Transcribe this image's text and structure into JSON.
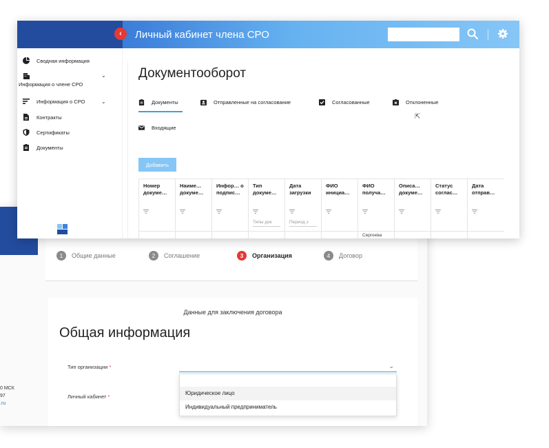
{
  "app": {
    "title": "Личный кабинет члена СРО",
    "search_placeholder": "",
    "accent_color": "#3f9fd8",
    "brand_color": "#234c9e",
    "danger_color": "#e53935"
  },
  "sidebar": {
    "items": [
      {
        "label": "Сводная информация",
        "icon": "chart-pie-icon",
        "expandable": false
      },
      {
        "label": "Информация о члене СРО",
        "icon": "building-icon",
        "expandable": true
      },
      {
        "label": "Информация о СРО",
        "icon": "list-icon",
        "expandable": true
      },
      {
        "label": "Контракты",
        "icon": "file-icon",
        "expandable": false
      },
      {
        "label": "Сертификаты",
        "icon": "shield-icon",
        "expandable": false
      },
      {
        "label": "Документы",
        "icon": "clipboard-icon",
        "expandable": false
      }
    ]
  },
  "main": {
    "title": "Документооборот",
    "tabs": [
      {
        "label": "Документы",
        "icon": "clipboard-icon",
        "active": true
      },
      {
        "label": "Отправленные на согласование",
        "icon": "contact-icon",
        "active": false
      },
      {
        "label": "Согласованные",
        "icon": "checkbox-icon",
        "active": false
      },
      {
        "label": "Отклоненные",
        "icon": "cancel-box-icon",
        "active": false
      },
      {
        "label": "Входящие",
        "icon": "mail-icon",
        "active": false
      }
    ],
    "add_button": "Добавить",
    "table": {
      "columns": [
        {
          "label": "Номер докуме…",
          "filter_placeholder": ""
        },
        {
          "label": "Наиме… докуме…",
          "filter_placeholder": ""
        },
        {
          "label": "Инфор… о подпис…",
          "filter_placeholder": ""
        },
        {
          "label": "Тип докуме…",
          "filter_placeholder": "Типы док"
        },
        {
          "label": "Дата загрузки",
          "filter_placeholder": "Период з"
        },
        {
          "label": "ФИО инициа…",
          "filter_placeholder": ""
        },
        {
          "label": "ФИО получа…",
          "filter_placeholder": ""
        },
        {
          "label": "Описа… докуме…",
          "filter_placeholder": ""
        },
        {
          "label": "Статус соглас…",
          "filter_placeholder": ""
        },
        {
          "label": "Дата отправ…",
          "filter_placeholder": ""
        }
      ],
      "first_row": [
        "",
        "",
        "",
        "",
        "",
        "",
        "Сергеева",
        "",
        "",
        ""
      ]
    }
  },
  "wizard": {
    "steps": [
      {
        "num": "1",
        "label": "Общие данные",
        "active": false
      },
      {
        "num": "2",
        "label": "Соглашение",
        "active": false
      },
      {
        "num": "3",
        "label": "Организация",
        "active": true
      },
      {
        "num": "4",
        "label": "Договор",
        "active": false
      }
    ],
    "form_header": "Данные для заключения договора",
    "section_title": "Общая информация",
    "org_type_label": "Тип организации",
    "cabinet_label": "Личный кабинет",
    "required_mark": "*",
    "org_type_value": "",
    "options": [
      "Юридическое лицо",
      "Индивидуальный предприниматель"
    ],
    "left_info": [
      "0 МСК",
      "97",
      ".ru"
    ]
  }
}
